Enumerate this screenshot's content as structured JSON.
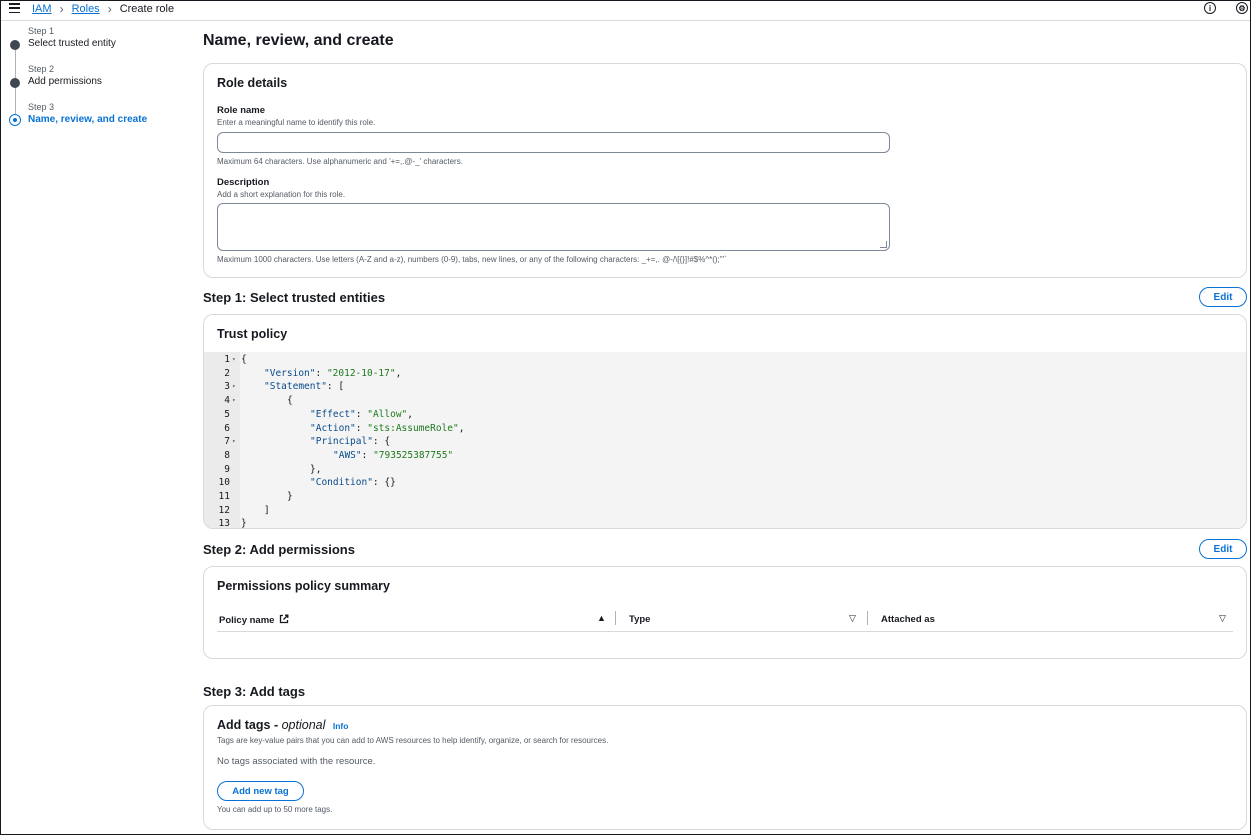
{
  "breadcrumb": {
    "item1": "IAM",
    "item2": "Roles",
    "current": "Create role"
  },
  "header_icons": [
    "info-icon",
    "settings-icon"
  ],
  "steps": [
    {
      "num": "Step 1",
      "label": "Select trusted entity"
    },
    {
      "num": "Step 2",
      "label": "Add permissions"
    },
    {
      "num": "Step 3",
      "label": "Name, review, and create"
    }
  ],
  "page_title": "Name, review, and create",
  "role_details": {
    "title": "Role details",
    "role_name_label": "Role name",
    "role_name_hint": "Enter a meaningful name to identify this role.",
    "role_name_value": "",
    "role_name_constraint": "Maximum 64 characters. Use alphanumeric and '+=,.@-_' characters.",
    "description_label": "Description",
    "description_hint": "Add a short explanation for this role.",
    "description_value": "",
    "description_constraint": "Maximum 1000 characters. Use letters (A-Z and a-z), numbers (0-9), tabs, new lines, or any of the following characters: _+=,. @-/\\[{}]!#$%^*();'\"`"
  },
  "step1": {
    "heading": "Step 1: Select trusted entities",
    "edit_label": "Edit",
    "card_title": "Trust policy",
    "code_lines": [
      {
        "n": "1",
        "fold": true,
        "text": "{"
      },
      {
        "n": "2",
        "fold": false,
        "indent": 1,
        "key": "\"Version\"",
        "sep": ": ",
        "val": "\"2012-10-17\"",
        "tail": ","
      },
      {
        "n": "3",
        "fold": true,
        "indent": 1,
        "key": "\"Statement\"",
        "sep": ": ",
        "tail": "["
      },
      {
        "n": "4",
        "fold": true,
        "indent": 2,
        "text": "{"
      },
      {
        "n": "5",
        "fold": false,
        "indent": 3,
        "key": "\"Effect\"",
        "sep": ": ",
        "val": "\"Allow\"",
        "tail": ","
      },
      {
        "n": "6",
        "fold": false,
        "indent": 3,
        "key": "\"Action\"",
        "sep": ": ",
        "val": "\"sts:AssumeRole\"",
        "tail": ","
      },
      {
        "n": "7",
        "fold": true,
        "indent": 3,
        "key": "\"Principal\"",
        "sep": ": ",
        "tail": "{"
      },
      {
        "n": "8",
        "fold": false,
        "indent": 4,
        "key": "\"AWS\"",
        "sep": ": ",
        "val": "\"793525387755\""
      },
      {
        "n": "9",
        "fold": false,
        "indent": 3,
        "text": "},"
      },
      {
        "n": "10",
        "fold": false,
        "indent": 3,
        "key": "\"Condition\"",
        "sep": ": ",
        "tail": "{}"
      },
      {
        "n": "11",
        "fold": false,
        "indent": 2,
        "text": "}"
      },
      {
        "n": "12",
        "fold": false,
        "indent": 1,
        "text": "]"
      },
      {
        "n": "13",
        "fold": false,
        "text": "}"
      }
    ]
  },
  "step2": {
    "heading": "Step 2: Add permissions",
    "edit_label": "Edit",
    "card_title": "Permissions policy summary",
    "columns": [
      "Policy name",
      "Type",
      "Attached as"
    ]
  },
  "step3": {
    "heading": "Step 3: Add tags",
    "card_title": "Add tags - ",
    "card_title_italic": "optional",
    "info_link": "Info",
    "description": "Tags are key-value pairs that you can add to AWS resources to help identify, organize, or search for resources.",
    "empty_text": "No tags associated with the resource.",
    "add_button": "Add new tag",
    "limit_text": "You can add up to 50 more tags."
  },
  "colors": {
    "accent": "#0972d3",
    "border": "#d5dbdb",
    "code_key": "#0a4b8a",
    "code_string": "#1d7a1d"
  }
}
